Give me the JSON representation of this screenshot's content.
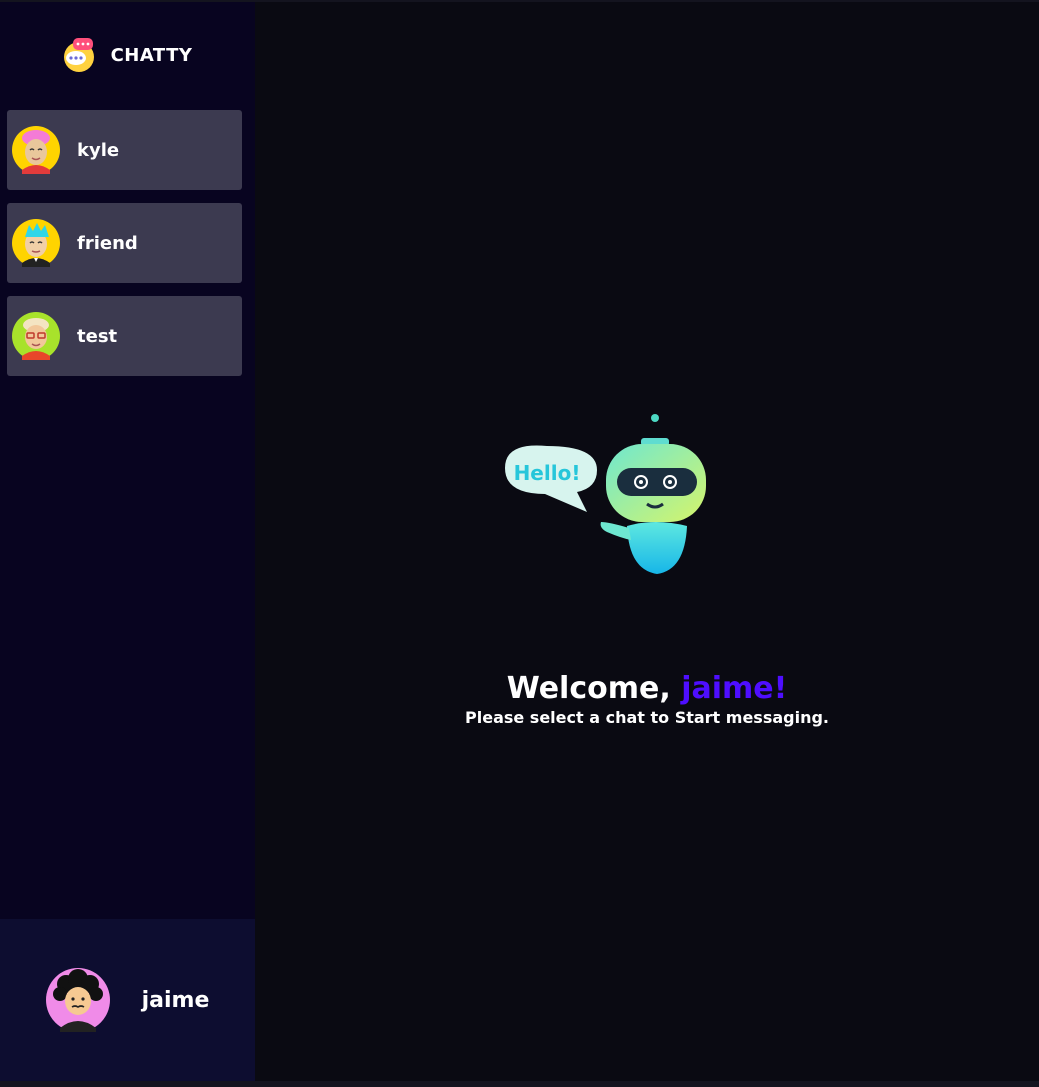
{
  "app": {
    "brand": "CHATTY",
    "brand_icon": "chat-bubbles-logo",
    "accent_color": "#4e0eff"
  },
  "contacts": [
    {
      "name": "kyle",
      "avatar": "avatar-pink-hair"
    },
    {
      "name": "friend",
      "avatar": "avatar-cyan-hair"
    },
    {
      "name": "test",
      "avatar": "avatar-glasses"
    }
  ],
  "current_user": {
    "name": "jaime",
    "avatar": "avatar-curly-hair"
  },
  "welcome": {
    "greeting": "Welcome, ",
    "username": "jaime!",
    "subtitle": "Please select a chat to Start messaging.",
    "robot_bubble": "Hello!"
  }
}
